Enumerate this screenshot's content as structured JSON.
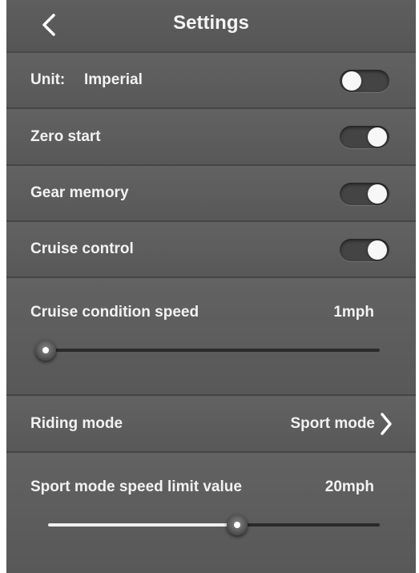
{
  "header": {
    "title": "Settings",
    "back_icon": "chevron-left-icon"
  },
  "unit": {
    "label": "Unit:",
    "value": "Imperial",
    "enabled": false
  },
  "zero_start": {
    "label": "Zero start",
    "enabled": true
  },
  "gear_memory": {
    "label": "Gear memory",
    "enabled": true
  },
  "cruise_control": {
    "label": "Cruise control",
    "enabled": true
  },
  "cruise_speed": {
    "label": "Cruise condition speed",
    "value": "1mph",
    "slider_fraction": 0.0
  },
  "riding_mode": {
    "label": "Riding mode",
    "value": "Sport mode",
    "icon": "chevron-right-icon"
  },
  "sport_speed": {
    "label": "Sport mode speed limit value",
    "value": "20mph",
    "slider_fraction": 0.57
  },
  "colors": {
    "background": "#5a5a5a",
    "text": "#f2f2f2",
    "toggle_knob": "#f7f7f7"
  }
}
